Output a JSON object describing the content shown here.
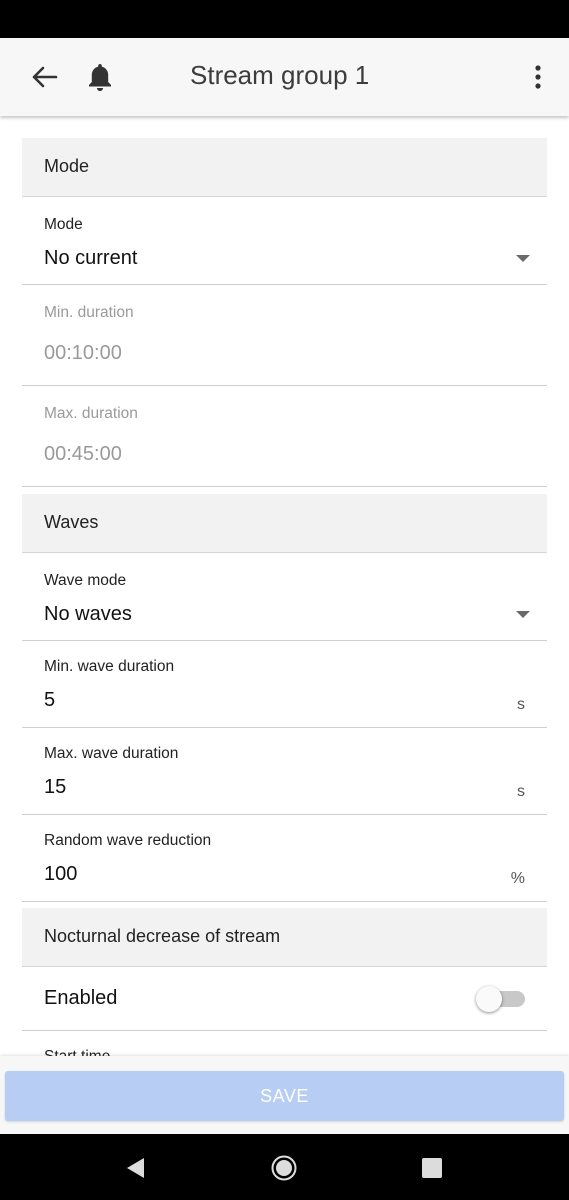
{
  "app_bar": {
    "title": "Stream group 1",
    "icons": [
      "arrow-back-icon",
      "bell-icon",
      "more-vert-icon"
    ]
  },
  "sections": {
    "mode": {
      "header": "Mode",
      "mode_field": {
        "label": "Mode",
        "value": "No current"
      },
      "min_duration": {
        "label": "Min. duration",
        "value": "00:10:00"
      },
      "max_duration": {
        "label": "Max. duration",
        "value": "00:45:00"
      }
    },
    "waves": {
      "header": "Waves",
      "wave_mode": {
        "label": "Wave mode",
        "value": "No waves"
      },
      "min_wave_duration": {
        "label": "Min. wave duration",
        "value": "5",
        "unit": "s"
      },
      "max_wave_duration": {
        "label": "Max. wave duration",
        "value": "15",
        "unit": "s"
      },
      "random_wave_reduction": {
        "label": "Random wave reduction",
        "value": "100",
        "unit": "%"
      }
    },
    "nocturnal": {
      "header": "Nocturnal decrease of stream",
      "enabled": {
        "label": "Enabled",
        "state": false
      },
      "start_time_label": "Start time"
    }
  },
  "footer": {
    "save_label": "SAVE",
    "save_enabled": false
  },
  "colors": {
    "save_button": "#b7cdf3",
    "header_bg": "#f2f2f2",
    "app_bar_bg": "#f7f7f7"
  }
}
